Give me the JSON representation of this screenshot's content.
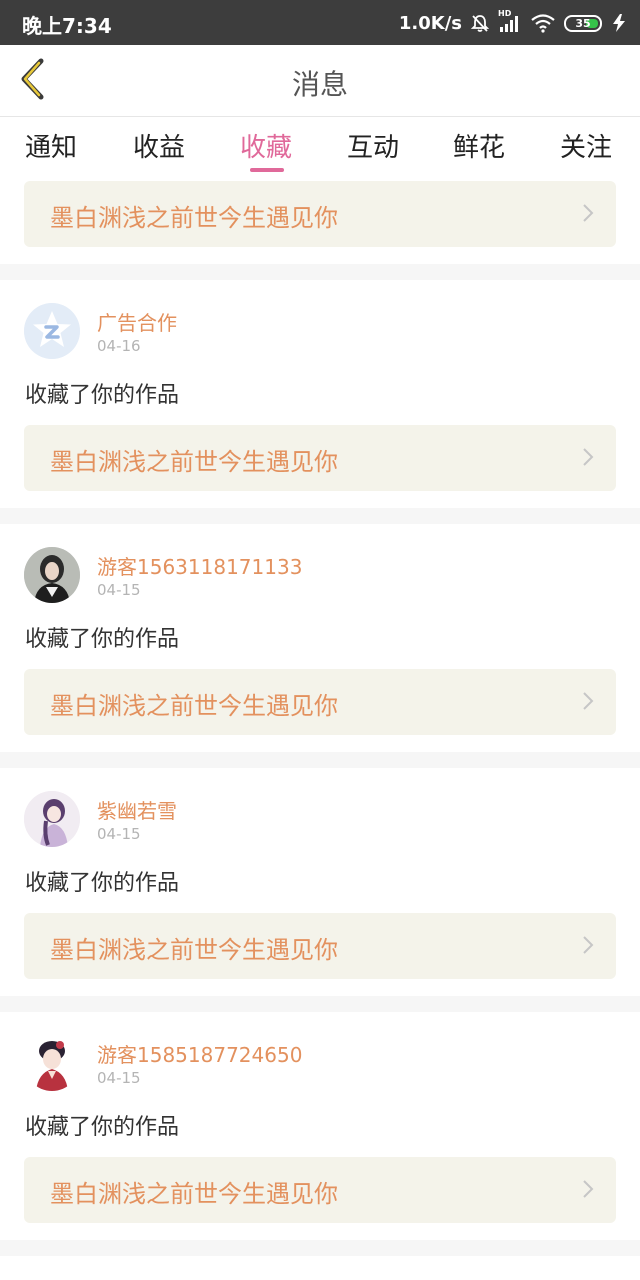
{
  "status_bar": {
    "time": "晚上7:34",
    "network_speed": "1.0K/s",
    "hd_label": "HD",
    "battery_level": "35",
    "icons": [
      "mute-bell-icon",
      "signal-icon",
      "wifi-icon",
      "battery-icon",
      "charging-icon"
    ]
  },
  "header": {
    "title": "消息",
    "back_icon": "chevron-left-icon"
  },
  "tabs": [
    {
      "label": "通知"
    },
    {
      "label": "收益"
    },
    {
      "label": "收藏",
      "active": true
    },
    {
      "label": "互动"
    },
    {
      "label": "鲜花"
    },
    {
      "label": "关注"
    }
  ],
  "colors": {
    "accent": "#e0699a",
    "username": "#e3915e",
    "work_bar_bg": "#f4f3ea",
    "status_bar_bg": "#3d3d3d"
  },
  "top_work": {
    "title": "墨白渊浅之前世今生遇见你"
  },
  "items": [
    {
      "username": "广告合作",
      "date": "04-16",
      "action": "收藏了你的作品",
      "work_title": "墨白渊浅之前世今生遇见你"
    },
    {
      "username": "游客1563118171133",
      "date": "04-15",
      "action": "收藏了你的作品",
      "work_title": "墨白渊浅之前世今生遇见你"
    },
    {
      "username": "紫幽若雪",
      "date": "04-15",
      "action": "收藏了你的作品",
      "work_title": "墨白渊浅之前世今生遇见你"
    },
    {
      "username": "游客1585187724650",
      "date": "04-15",
      "action": "收藏了你的作品",
      "work_title": "墨白渊浅之前世今生遇见你"
    }
  ]
}
